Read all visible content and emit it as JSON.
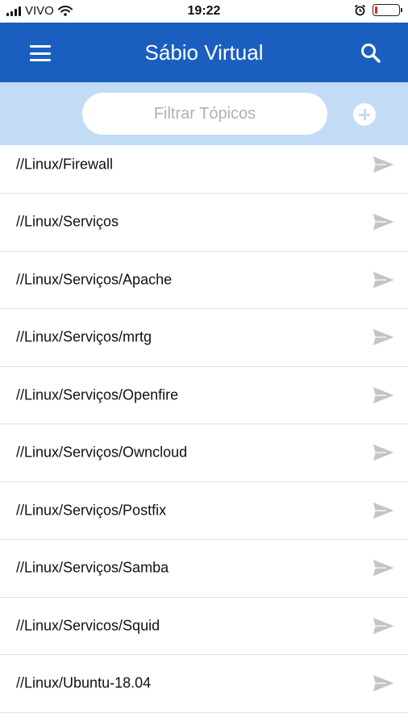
{
  "status_bar": {
    "carrier": "VIVO",
    "time": "19:22",
    "signal_icon": "signal-bars-icon",
    "wifi_icon": "wifi-icon",
    "alarm_icon": "alarm-clock-icon",
    "battery_icon": "battery-low-icon",
    "battery_level": 0.12
  },
  "app_bar": {
    "title": "Sábio Virtual",
    "menu_icon": "hamburger-menu-icon",
    "search_icon": "search-icon",
    "background_color": "#1a5fbf"
  },
  "filter": {
    "placeholder": "Filtrar Tópicos",
    "value": "",
    "add_icon": "add-circle-icon",
    "background_color": "#c2dcf5"
  },
  "topics": [
    {
      "label": "//Linux/Firewall",
      "icon": "send-icon"
    },
    {
      "label": "//Linux/Serviços",
      "icon": "send-icon"
    },
    {
      "label": "//Linux/Serviços/Apache",
      "icon": "send-icon"
    },
    {
      "label": "//Linux/Serviços/mrtg",
      "icon": "send-icon"
    },
    {
      "label": "//Linux/Serviços/Openfire",
      "icon": "send-icon"
    },
    {
      "label": "//Linux/Serviços/Owncloud",
      "icon": "send-icon"
    },
    {
      "label": "//Linux/Serviços/Postfix",
      "icon": "send-icon"
    },
    {
      "label": "//Linux/Serviços/Samba",
      "icon": "send-icon"
    },
    {
      "label": "//Linux/Servicos/Squid",
      "icon": "send-icon"
    },
    {
      "label": "//Linux/Ubuntu-18.04",
      "icon": "send-icon"
    }
  ]
}
